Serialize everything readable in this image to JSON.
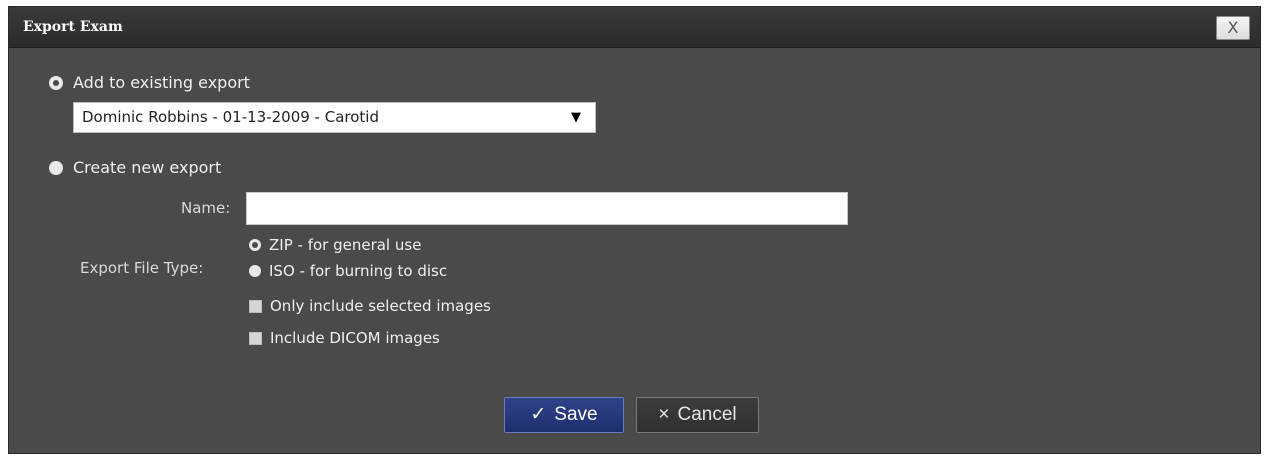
{
  "dialog": {
    "title": "Export Exam",
    "close_glyph": "X",
    "close_icon": "close-icon"
  },
  "existing_export": {
    "radio_label": "Add to existing export",
    "selected": true,
    "select_value": "Dominic Robbins - 01-13-2009 - Carotid",
    "select_arrow_glyph": "▼"
  },
  "new_export": {
    "radio_label": "Create new export",
    "selected": false,
    "name_label": "Name:",
    "name_value": "",
    "file_type_label": "Export File Type:",
    "file_types": [
      {
        "label": "ZIP - for general use",
        "selected": true
      },
      {
        "label": "ISO - for burning to disc",
        "selected": false
      }
    ],
    "options": [
      {
        "label": "Only include selected images",
        "checked": false
      },
      {
        "label": "Include DICOM images",
        "checked": false
      }
    ]
  },
  "actions": {
    "save_glyph": "✓",
    "save_label": "Save",
    "cancel_glyph": "×",
    "cancel_label": "Cancel"
  },
  "colors": {
    "dialog_bg": "#4a4a4a",
    "titlebar_bg": "#2b2b2b",
    "save_bg": "#1f2f6e",
    "text": "#f0f0f0"
  }
}
